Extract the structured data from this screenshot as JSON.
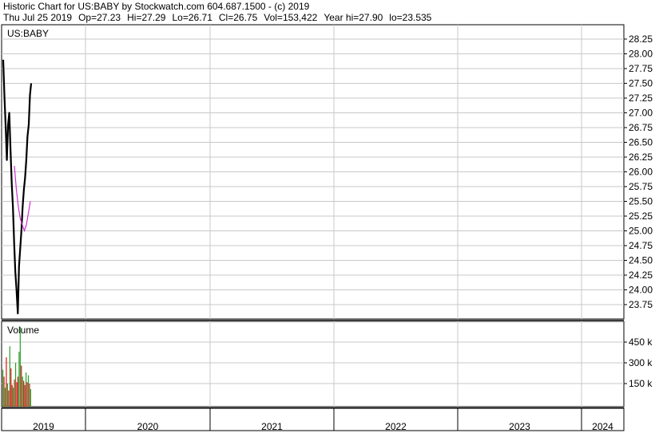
{
  "header": {
    "title": "Historic Chart for US:BABY by Stockwatch.com 604.687.1500 - (c) 2019",
    "date": "Thu Jul 25 2019",
    "open": "Op=27.23",
    "high": "Hi=27.29",
    "low": "Lo=26.71",
    "close": "Cl=26.75",
    "volume": "Vol=153,422",
    "year_high": "Year hi=27.90",
    "year_low": "lo=23.535"
  },
  "colors": {
    "price": "#000000",
    "moving_average": "#cc33cc",
    "volume_up": "#2aa02a",
    "volume_down": "#dd1111",
    "grid": "#c8c8c8",
    "frame": "#000000"
  },
  "chart_data": [
    {
      "type": "line",
      "panel": "price",
      "label": "US:BABY",
      "ylim": [
        23.5,
        28.4
      ],
      "y_ticks": [
        "28.25",
        "28.00",
        "27.75",
        "27.50",
        "27.25",
        "27.00",
        "26.75",
        "26.50",
        "26.25",
        "26.00",
        "25.75",
        "25.50",
        "25.25",
        "25.00",
        "24.75",
        "24.50",
        "24.25",
        "24.00",
        "23.75"
      ],
      "series": [
        {
          "role": "price",
          "values": [
            27.9,
            27.3,
            26.8,
            26.2,
            26.8,
            27.0,
            26.4,
            25.8,
            25.4,
            24.8,
            24.3,
            24.0,
            23.6,
            24.4,
            24.7,
            25.0,
            25.4,
            25.7,
            25.9,
            26.2,
            26.6,
            26.8,
            27.3,
            27.5
          ]
        },
        {
          "role": "moving_average",
          "values": [
            26.1,
            25.7,
            25.4,
            25.2,
            25.1,
            25.0,
            25.1,
            25.3,
            25.5
          ]
        }
      ]
    },
    {
      "type": "bar",
      "panel": "volume",
      "label": "Volume",
      "y_ticks": [
        "450 k",
        "300 k",
        "150 k"
      ],
      "ylim": [
        0,
        600
      ],
      "values": [
        250,
        200,
        120,
        340,
        150,
        100,
        420,
        260,
        140,
        120,
        180,
        300,
        160,
        200,
        380,
        560,
        280,
        200,
        170,
        140,
        230,
        160,
        210,
        150,
        110
      ],
      "up": [
        true,
        false,
        true,
        false,
        true,
        false,
        true,
        false,
        false,
        true,
        false,
        true,
        false,
        false,
        true,
        true,
        false,
        true,
        false,
        false,
        true,
        false,
        true,
        false,
        true
      ]
    }
  ],
  "x_axis": {
    "labels": [
      "2019",
      "2020",
      "2021",
      "2022",
      "2023",
      "2024"
    ]
  }
}
